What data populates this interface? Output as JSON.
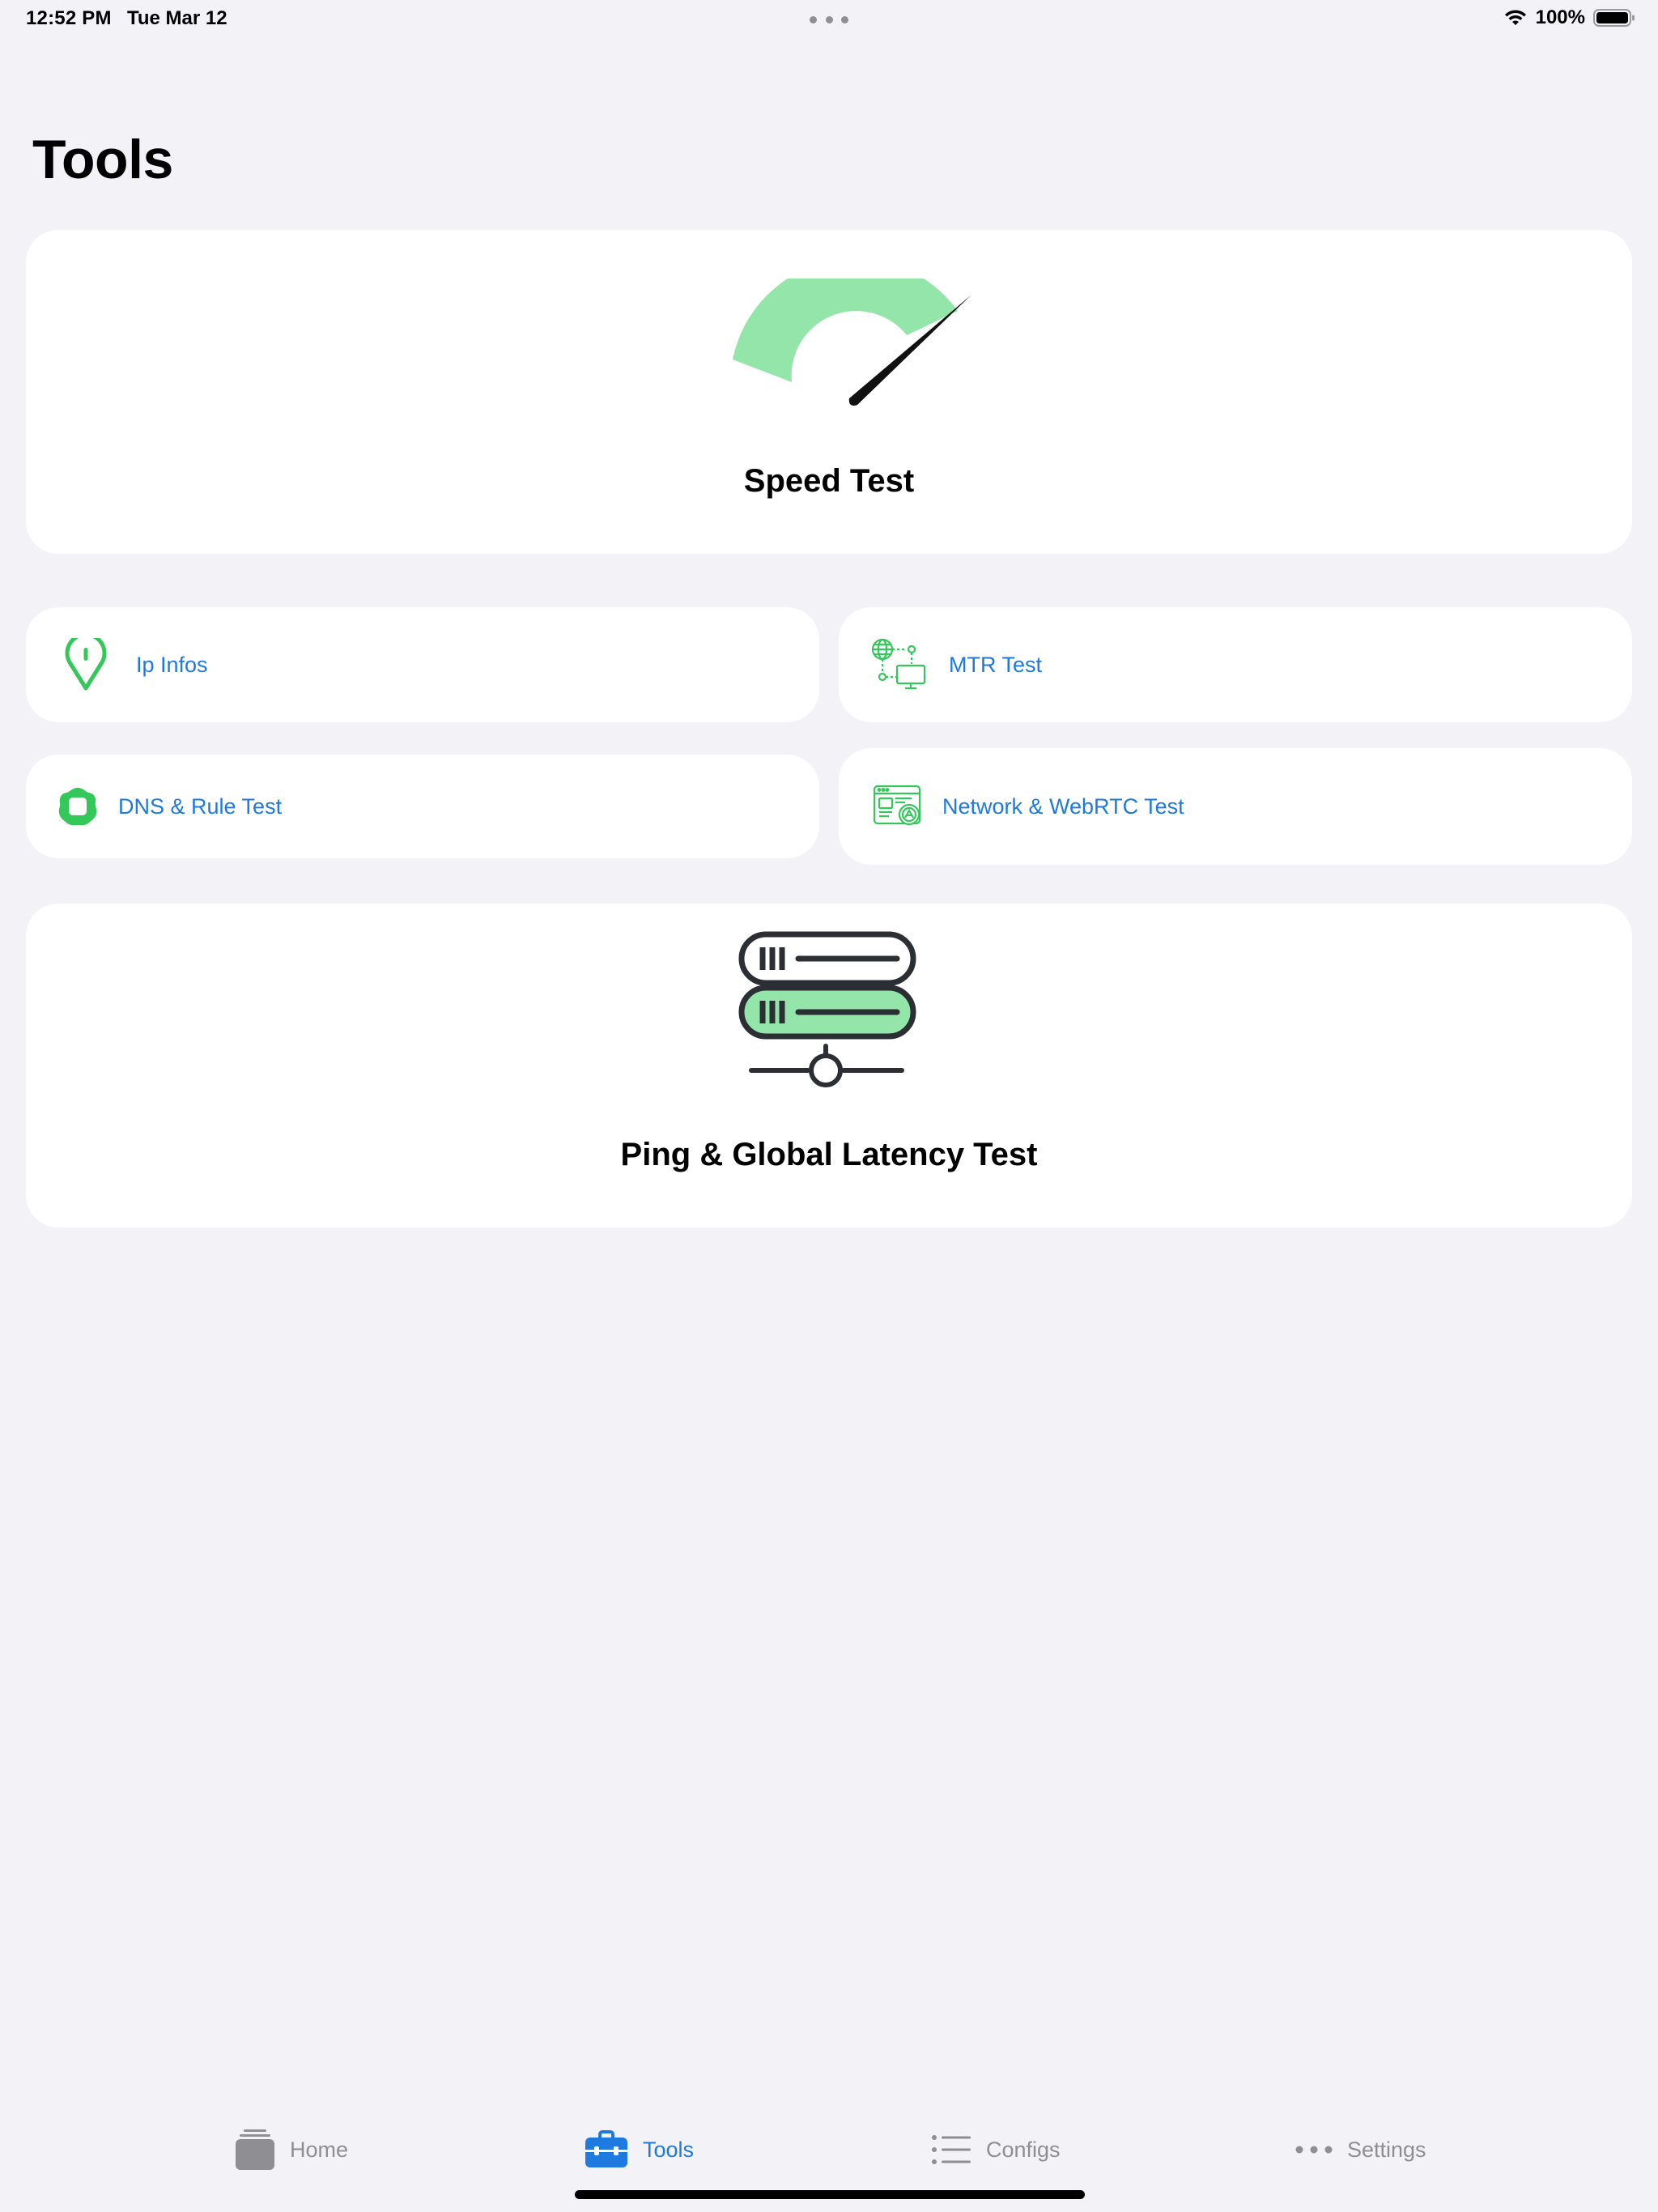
{
  "status_bar": {
    "time": "12:52 PM",
    "date": "Tue Mar 12",
    "battery": "100%"
  },
  "page": {
    "title": "Tools"
  },
  "tools": {
    "speed_test": "Speed Test",
    "ip_infos": "Ip Infos",
    "mtr_test": "MTR Test",
    "dns_rule_test": "DNS & Rule Test",
    "network_webrtc_test": "Network & WebRTC Test",
    "ping_latency_test": "Ping & Global Latency Test"
  },
  "tab_bar": {
    "items": [
      {
        "label": "Home",
        "icon": "home-stack-icon",
        "active": false
      },
      {
        "label": "Tools",
        "icon": "toolbox-icon",
        "active": true
      },
      {
        "label": "Configs",
        "icon": "list-icon",
        "active": false
      },
      {
        "label": "Settings",
        "icon": "ellipsis-icon",
        "active": false
      }
    ]
  },
  "colors": {
    "accent": "#1f7ae0",
    "green": "#34c759",
    "gauge_green": "#93e5a9",
    "background": "#f2f2f7"
  }
}
